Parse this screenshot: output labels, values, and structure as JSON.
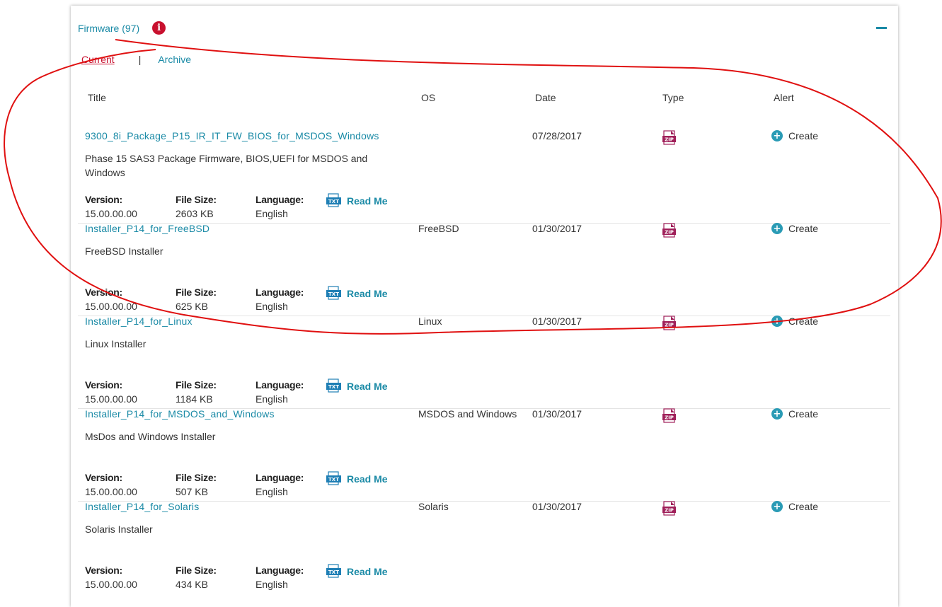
{
  "section": {
    "title": "Firmware (97)",
    "info_icon": "info-icon",
    "collapse_icon": "minus-icon"
  },
  "tabs": {
    "current": "Current",
    "separator": "|",
    "archive": "Archive"
  },
  "columns": {
    "title": "Title",
    "os": "OS",
    "date": "Date",
    "type": "Type",
    "alert": "Alert"
  },
  "labels": {
    "version": "Version:",
    "file_size": "File Size:",
    "language": "Language:",
    "read_me": "Read Me",
    "create": "Create"
  },
  "rows": [
    {
      "title": "9300_8i_Package_P15_IR_IT_FW_BIOS_for_MSDOS_Windows",
      "description": "Phase 15 SAS3 Package Firmware, BIOS,UEFI for MSDOS and Windows",
      "os": "",
      "date": "07/28/2017",
      "type": "ZIP",
      "version": "15.00.00.00",
      "file_size": "2603 KB",
      "language": "English"
    },
    {
      "title": "Installer_P14_for_FreeBSD",
      "description": "FreeBSD Installer",
      "os": "FreeBSD",
      "date": "01/30/2017",
      "type": "ZIP",
      "version": "15.00.00.00",
      "file_size": "625 KB",
      "language": "English"
    },
    {
      "title": "Installer_P14_for_Linux",
      "description": "Linux Installer",
      "os": "Linux",
      "date": "01/30/2017",
      "type": "ZIP",
      "version": "15.00.00.00",
      "file_size": "1184 KB",
      "language": "English"
    },
    {
      "title": "Installer_P14_for_MSDOS_and_Windows",
      "description": "MsDos and Windows Installer",
      "os": "MSDOS and Windows",
      "date": "01/30/2017",
      "type": "ZIP",
      "version": "15.00.00.00",
      "file_size": "507 KB",
      "language": "English"
    },
    {
      "title": "Installer_P14_for_Solaris",
      "description": "Solaris Installer",
      "os": "Solaris",
      "date": "01/30/2017",
      "type": "ZIP",
      "version": "15.00.00.00",
      "file_size": "434 KB",
      "language": "English"
    }
  ],
  "colors": {
    "link": "#1a8aa6",
    "accent_red": "#c8102e",
    "zip_icon": "#a0205a",
    "txt_icon": "#1f7fb5",
    "annotation": "#e01010"
  }
}
